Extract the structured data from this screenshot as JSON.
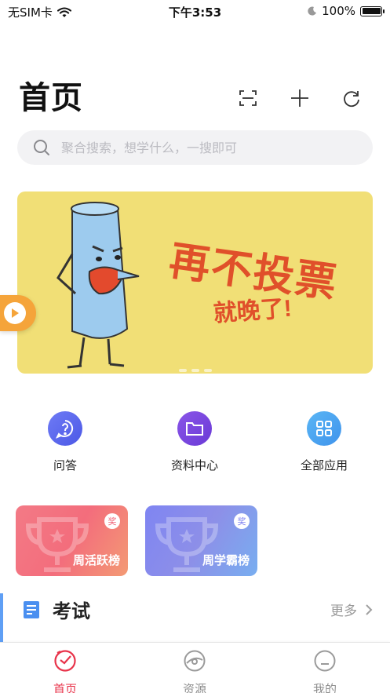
{
  "status_bar": {
    "carrier": "无SIM卡",
    "time": "下午3:53",
    "battery": "100%"
  },
  "header": {
    "title": "首页",
    "icons": [
      "scan-icon",
      "plus-icon",
      "refresh-icon"
    ]
  },
  "search": {
    "placeholder": "聚合搜索，想学什么，一搜即可"
  },
  "banner": {
    "headline": "再不投票",
    "subline": "就晚了!"
  },
  "apps": [
    {
      "label": "问答",
      "icon": "question-icon",
      "color": "#5b6cf0"
    },
    {
      "label": "资料中心",
      "icon": "folder-icon",
      "color": "#7b4ae0"
    },
    {
      "label": "全部应用",
      "icon": "grid-icon",
      "color": "#4aa6f0"
    }
  ],
  "ranks": [
    {
      "label": "周活跃榜",
      "badge": "奖"
    },
    {
      "label": "周学霸榜",
      "badge": "奖"
    }
  ],
  "exam_section": {
    "title": "考试",
    "more": "更多"
  },
  "tabbar": [
    {
      "label": "首页",
      "active": true
    },
    {
      "label": "资源",
      "active": false
    },
    {
      "label": "我的",
      "active": false
    }
  ],
  "colors": {
    "accent": "#e8334a",
    "banner_bg": "#f1df76",
    "section_accent": "#5f9ff5"
  }
}
